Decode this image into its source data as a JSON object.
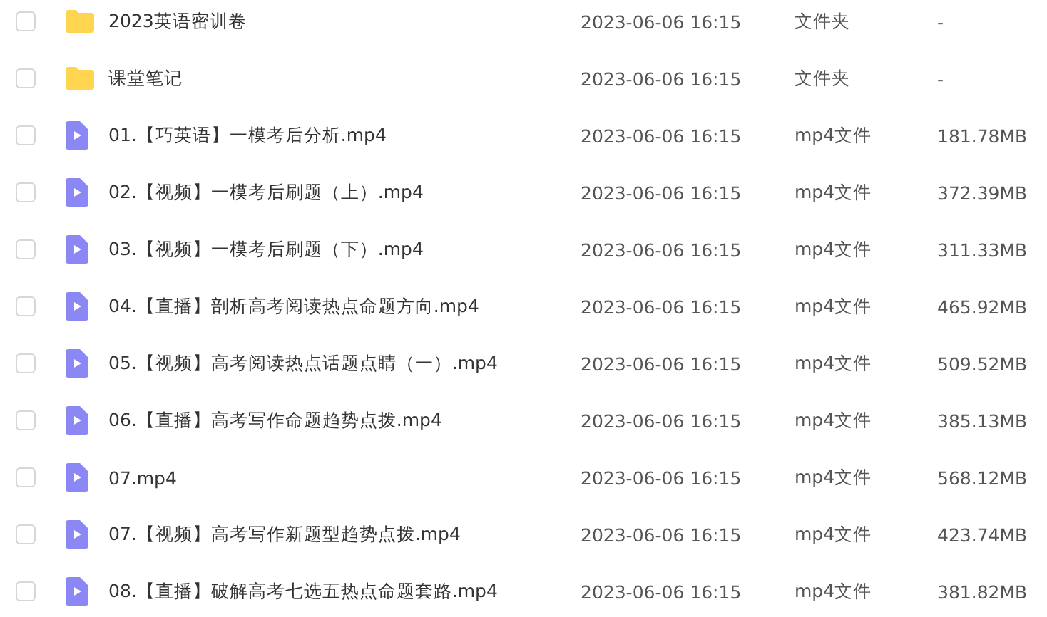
{
  "files": [
    {
      "kind": "folder",
      "checked": false,
      "name": "2023英语密训卷",
      "modified": "2023-06-06 16:15",
      "type": "文件夹",
      "size": "-"
    },
    {
      "kind": "folder",
      "checked": false,
      "name": "课堂笔记",
      "modified": "2023-06-06 16:15",
      "type": "文件夹",
      "size": "-"
    },
    {
      "kind": "video",
      "checked": false,
      "name": "01.【巧英语】一模考后分析.mp4",
      "modified": "2023-06-06 16:15",
      "type": "mp4文件",
      "size": "181.78MB"
    },
    {
      "kind": "video",
      "checked": false,
      "name": "02.【视频】一模考后刷题（上）.mp4",
      "modified": "2023-06-06 16:15",
      "type": "mp4文件",
      "size": "372.39MB"
    },
    {
      "kind": "video",
      "checked": false,
      "name": "03.【视频】一模考后刷题（下）.mp4",
      "modified": "2023-06-06 16:15",
      "type": "mp4文件",
      "size": "311.33MB"
    },
    {
      "kind": "video",
      "checked": false,
      "name": "04.【直播】剖析高考阅读热点命题方向.mp4",
      "modified": "2023-06-06 16:15",
      "type": "mp4文件",
      "size": "465.92MB"
    },
    {
      "kind": "video",
      "checked": false,
      "name": "05.【视频】高考阅读热点话题点睛（一）.mp4",
      "modified": "2023-06-06 16:15",
      "type": "mp4文件",
      "size": "509.52MB"
    },
    {
      "kind": "video",
      "checked": false,
      "name": "06.【直播】高考写作命题趋势点拨.mp4",
      "modified": "2023-06-06 16:15",
      "type": "mp4文件",
      "size": "385.13MB"
    },
    {
      "kind": "video",
      "checked": false,
      "name": "07.mp4",
      "modified": "2023-06-06 16:15",
      "type": "mp4文件",
      "size": "568.12MB"
    },
    {
      "kind": "video",
      "checked": false,
      "name": "07.【视频】高考写作新题型趋势点拨.mp4",
      "modified": "2023-06-06 16:15",
      "type": "mp4文件",
      "size": "423.74MB"
    },
    {
      "kind": "video",
      "checked": false,
      "name": "08.【直播】破解高考七选五热点命题套路.mp4",
      "modified": "2023-06-06 16:15",
      "type": "mp4文件",
      "size": "381.82MB"
    }
  ]
}
